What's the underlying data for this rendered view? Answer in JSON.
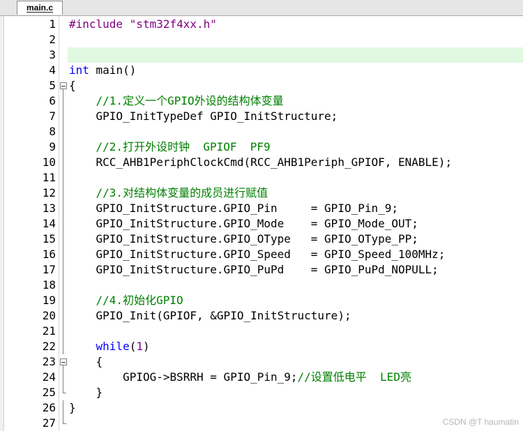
{
  "tab": {
    "label": "main.c"
  },
  "editor": {
    "current_line": 3,
    "lines": [
      {
        "n": "1",
        "tokens": [
          {
            "t": "#include ",
            "c": "prep"
          },
          {
            "t": "\"stm32f4xx.h\"",
            "c": "str"
          }
        ]
      },
      {
        "n": "2",
        "tokens": []
      },
      {
        "n": "3",
        "tokens": []
      },
      {
        "n": "4",
        "tokens": [
          {
            "t": "int",
            "c": "kw"
          },
          {
            "t": " main()",
            "c": ""
          }
        ]
      },
      {
        "n": "5",
        "tokens": [
          {
            "t": "{",
            "c": ""
          }
        ]
      },
      {
        "n": "6",
        "tokens": [
          {
            "t": "    //1.定义一个GPIO外设的结构体变量",
            "c": "cmt"
          }
        ]
      },
      {
        "n": "7",
        "tokens": [
          {
            "t": "    GPIO_InitTypeDef GPIO_InitStructure;",
            "c": ""
          }
        ]
      },
      {
        "n": "8",
        "tokens": []
      },
      {
        "n": "9",
        "tokens": [
          {
            "t": "    //2.打开外设时钟  GPIOF  PF9",
            "c": "cmt"
          }
        ]
      },
      {
        "n": "10",
        "tokens": [
          {
            "t": "    RCC_AHB1PeriphClockCmd(RCC_AHB1Periph_GPIOF, ENABLE);",
            "c": ""
          }
        ]
      },
      {
        "n": "11",
        "tokens": []
      },
      {
        "n": "12",
        "tokens": [
          {
            "t": "    //3.对结构体变量的成员进行赋值",
            "c": "cmt"
          }
        ]
      },
      {
        "n": "13",
        "tokens": [
          {
            "t": "    GPIO_InitStructure.GPIO_Pin     = GPIO_Pin_9;",
            "c": ""
          }
        ]
      },
      {
        "n": "14",
        "tokens": [
          {
            "t": "    GPIO_InitStructure.GPIO_Mode    = GPIO_Mode_OUT;",
            "c": ""
          }
        ]
      },
      {
        "n": "15",
        "tokens": [
          {
            "t": "    GPIO_InitStructure.GPIO_OType   = GPIO_OType_PP;",
            "c": ""
          }
        ]
      },
      {
        "n": "16",
        "tokens": [
          {
            "t": "    GPIO_InitStructure.GPIO_Speed   = GPIO_Speed_100MHz;",
            "c": ""
          }
        ]
      },
      {
        "n": "17",
        "tokens": [
          {
            "t": "    GPIO_InitStructure.GPIO_PuPd    = GPIO_PuPd_NOPULL;",
            "c": ""
          }
        ]
      },
      {
        "n": "18",
        "tokens": []
      },
      {
        "n": "19",
        "tokens": [
          {
            "t": "    //4.初始化GPIO",
            "c": "cmt"
          }
        ]
      },
      {
        "n": "20",
        "tokens": [
          {
            "t": "    GPIO_Init(GPIOF, &GPIO_InitStructure);",
            "c": ""
          }
        ]
      },
      {
        "n": "21",
        "tokens": []
      },
      {
        "n": "22",
        "tokens": [
          {
            "t": "    ",
            "c": ""
          },
          {
            "t": "while",
            "c": "kw"
          },
          {
            "t": "(",
            "c": ""
          },
          {
            "t": "1",
            "c": "num"
          },
          {
            "t": ")",
            "c": ""
          }
        ]
      },
      {
        "n": "23",
        "tokens": [
          {
            "t": "    {",
            "c": ""
          }
        ]
      },
      {
        "n": "24",
        "tokens": [
          {
            "t": "        GPIOG->BSRRH = GPIO_Pin_9;",
            "c": ""
          },
          {
            "t": "//设置低电平  LED亮",
            "c": "cmt"
          }
        ]
      },
      {
        "n": "25",
        "tokens": [
          {
            "t": "    }",
            "c": ""
          }
        ]
      },
      {
        "n": "26",
        "tokens": [
          {
            "t": "}",
            "c": ""
          }
        ]
      },
      {
        "n": "27",
        "tokens": []
      }
    ]
  },
  "watermark": {
    "text": "CSDN @T  haumatin"
  },
  "colors": {
    "current_line_bg": "#e0f9e0",
    "comment": "#008000",
    "keyword": "#0000ff",
    "preprocessor": "#800080"
  }
}
